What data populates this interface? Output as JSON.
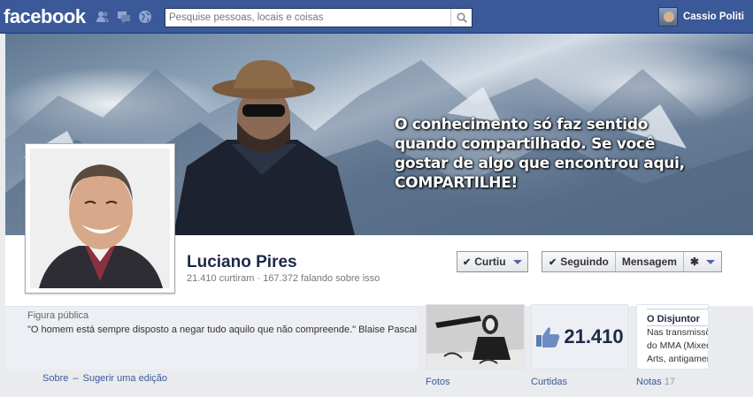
{
  "topbar": {
    "logo": "facebook",
    "search_placeholder": "Pesquise pessoas, locais e coisas",
    "user_name": "Cassio Politi"
  },
  "cover": {
    "quote": "O conhecimento só faz sentido quando compartilhado. Se você gostar de algo que encontrou aqui, COMPARTILHE!"
  },
  "profile": {
    "name": "Luciano Pires",
    "stats": "21.410 curtiram · 167.372 falando sobre isso",
    "buttons": {
      "like": "Curtiu",
      "follow": "Seguindo",
      "message": "Mensagem"
    }
  },
  "about": {
    "category": "Figura pública",
    "quote": "\"O homem está sempre disposto a negar tudo aquilo que não compreende.\" Blaise Pascal",
    "link_about": "Sobre",
    "link_separator": "–",
    "link_suggest": "Sugerir uma edição"
  },
  "apps": {
    "photos_label": "Fotos",
    "likes_count": "21.410",
    "likes_label": "Curtidas",
    "notes_title": "O Disjuntor",
    "notes_lines": [
      "Nas transmissões das",
      "do MMA (Mixed Marti",
      "Arts, antigamente"
    ],
    "notes_label": "Notas",
    "notes_count": "17"
  },
  "colors": {
    "brand": "#3b5998",
    "name_text": "#1c2a47",
    "link": "#3b5998"
  }
}
